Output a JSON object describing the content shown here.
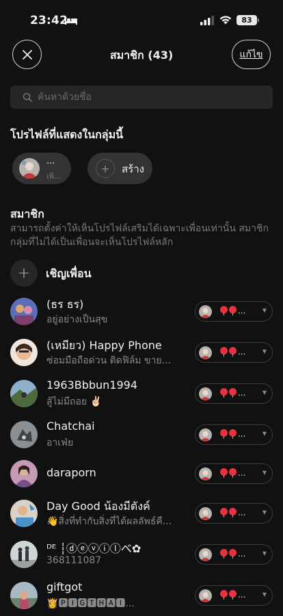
{
  "status_bar": {
    "time": "23:42",
    "battery": "83"
  },
  "header": {
    "title": "สมาชิก (43)",
    "edit_label": "แก้ไข"
  },
  "search": {
    "placeholder": "ค้นหาด้วยชื่อ"
  },
  "profiles_section": {
    "title": "โปรไฟล์ที่แสดงในกลุ่มนี้",
    "profile_chip": {
      "name": "...",
      "subtitle": "เพิ..."
    },
    "create_label": "สร้าง"
  },
  "members_section": {
    "title": "สมาชิก",
    "description": "สามารถตั้งค่าให้เห็นโปรไฟล์เสริมได้เฉพาะเพื่อนเท่านั้น สมาชิกกลุ่มที่ไม่ได้เป็นเพื่อนจะเห็นโปรไฟล์หลัก",
    "invite_label": "เชิญเพื่อน",
    "pill_suffix": "...",
    "members": [
      {
        "name": "(ธร ธร)",
        "status": "อยู่อย่างเป็นสุข"
      },
      {
        "name": "(เหมียว) Happy Phone",
        "status": "ซ่อมมือถือด่วน ติดฟิล์ม ขาย..."
      },
      {
        "name": "1963Bbbun1994",
        "status": "สู้ไม่มีถอย ✌🏻"
      },
      {
        "name": "Chatchai",
        "status": "อาเฟ่ย"
      },
      {
        "name": "daraporn",
        "status": ""
      },
      {
        "name": "Day Good น้องมีตังค์",
        "status": "👋สิ่งที่ทำกับสิ่งที่ได้ผลลัพธ์คื..."
      },
      {
        "name": "ᴰᴱ ┆ⓓⓔⓥⓘⓛべ✿",
        "status": "368111087"
      },
      {
        "name": "giftgot",
        "status": "👸🅿🅸🅶🆃🅷🅰🅸..."
      }
    ]
  },
  "colors": {
    "background": "#111111",
    "surface": "#262626",
    "chip": "#333333",
    "muted_text": "#7a7a7a",
    "balloon": "#e8323f"
  }
}
